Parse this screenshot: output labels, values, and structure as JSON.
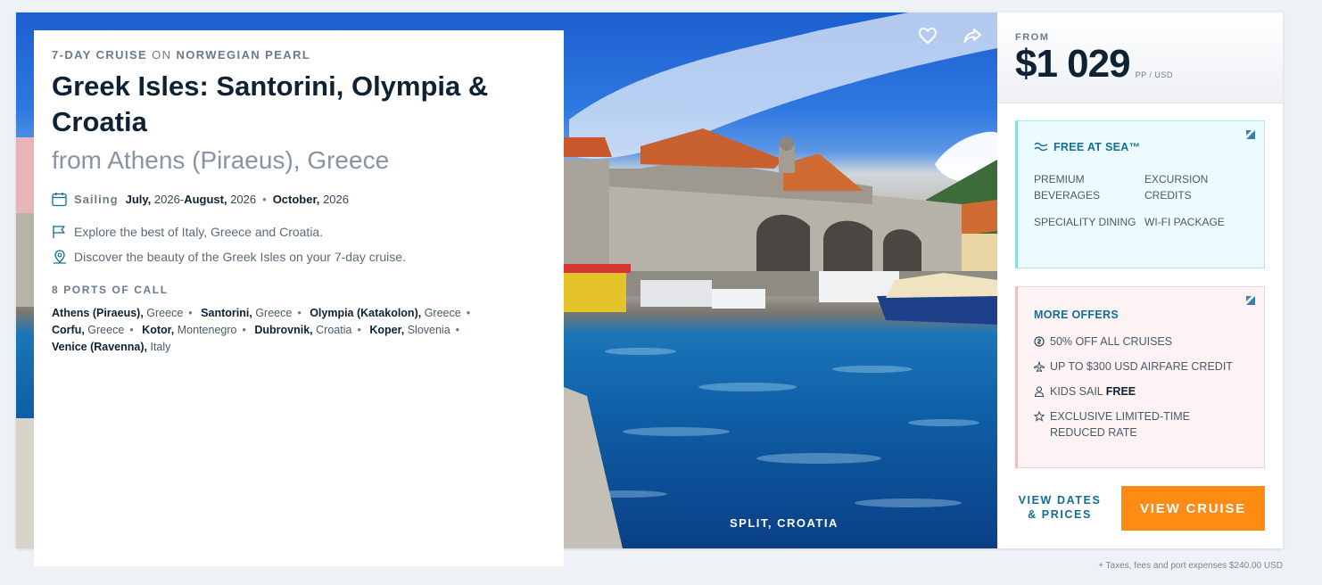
{
  "photo": {
    "caption": "SPLIT, CROATIA",
    "favorite_icon": "heart-icon",
    "share_icon": "share-icon"
  },
  "cruise": {
    "duration": "7-DAY CRUISE",
    "on": "ON",
    "ship": "NORWEGIAN PEARL",
    "title": "Greek Isles: Santorini, Olympia & Croatia",
    "subtitle": "from Athens (Piraeus), Greece",
    "sailing_label": "Sailing",
    "sailing": {
      "m1": "July,",
      "y1": "2026",
      "dash": "-",
      "m2": "August,",
      "y2": "2026",
      "m3": "October,",
      "y3": "2026"
    },
    "highlights": [
      "Explore the best of Italy, Greece and Croatia.",
      "Discover the beauty of the Greek Isles on your 7-day cruise."
    ],
    "ports_title": "8 PORTS OF CALL",
    "ports": [
      {
        "name": "Athens (Piraeus),",
        "country": "Greece"
      },
      {
        "name": "Santorini,",
        "country": "Greece"
      },
      {
        "name": "Olympia (Katakolon),",
        "country": "Greece"
      },
      {
        "name": "Corfu,",
        "country": "Greece"
      },
      {
        "name": "Kotor,",
        "country": "Montenegro"
      },
      {
        "name": "Dubrovnik,",
        "country": "Croatia"
      },
      {
        "name": "Koper,",
        "country": "Slovenia"
      },
      {
        "name": "Venice (Ravenna),",
        "country": "Italy"
      }
    ]
  },
  "pricing": {
    "from_label": "FROM",
    "amount": "$1 029",
    "unit": "PP / USD",
    "taxes_note": "+ Taxes, fees and port expenses $240.00 USD"
  },
  "free_at_sea": {
    "title": "FREE AT SEA™",
    "items": [
      "PREMIUM BEVERAGES",
      "EXCURSION CREDITS",
      "SPECIALITY DINING",
      "WI-FI PACKAGE"
    ]
  },
  "more_offers": {
    "title": "MORE OFFERS",
    "items": [
      {
        "text": "50% OFF ALL CRUISES",
        "icon": "percent-icon"
      },
      {
        "text": "UP TO $300 USD AIRFARE CREDIT",
        "icon": "plane-icon"
      },
      {
        "text": "KIDS SAIL",
        "bold": "FREE",
        "icon": "person-icon"
      },
      {
        "text": "EXCLUSIVE LIMITED-TIME REDUCED RATE",
        "icon": "star-icon"
      }
    ]
  },
  "actions": {
    "view_dates_line1": "VIEW DATES",
    "view_dates_line2": "& PRICES",
    "view_cruise": "VIEW CRUISE"
  },
  "colors": {
    "accent_orange": "#ff8a14",
    "link_teal": "#116e95",
    "free_box_bg": "#ecfbfd",
    "offers_box_bg": "#fdf3f4"
  }
}
